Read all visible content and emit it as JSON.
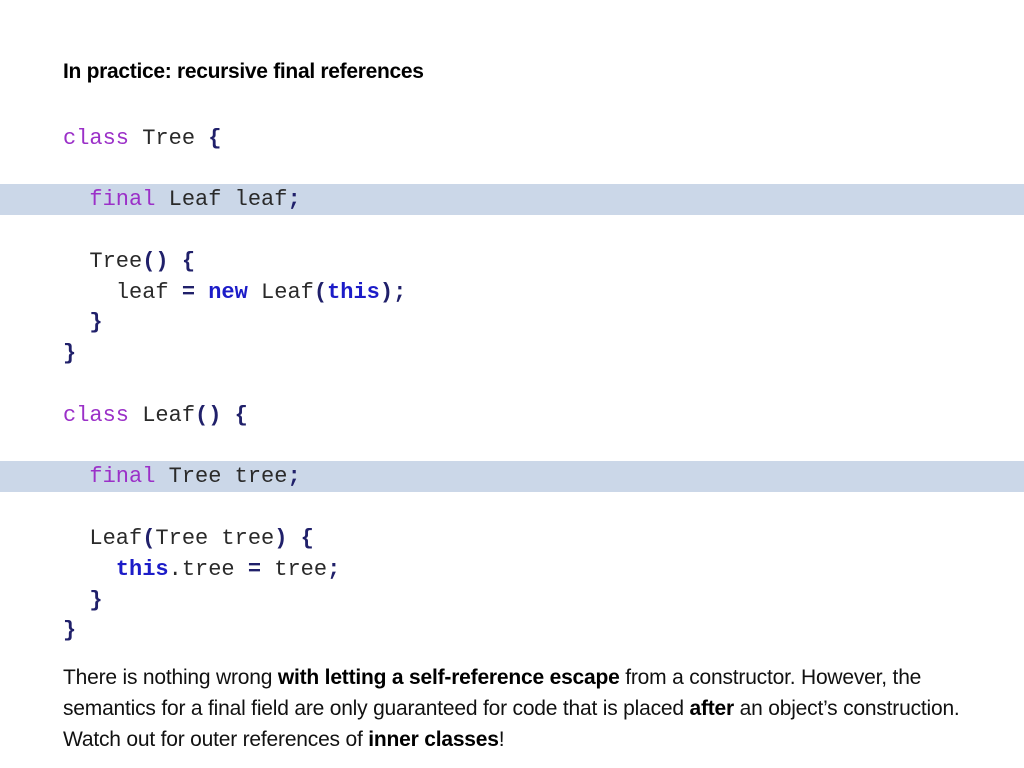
{
  "slide": {
    "title": "In practice: recursive final references"
  },
  "code": {
    "l1": {
      "kw": "class",
      "name": " Tree ",
      "brace": "{"
    },
    "l2": {
      "indent": "  ",
      "kw": "final",
      "rest": " Leaf leaf",
      "semi": ";"
    },
    "l3": {
      "indent": "  ",
      "name": "Tree",
      "parens": "()",
      "sp": " ",
      "brace": "{"
    },
    "l4": {
      "indent": "    ",
      "lhs": "leaf ",
      "eq": "=",
      "sp": " ",
      "new": "new",
      "cls": " Leaf",
      "open": "(",
      "this": "this",
      "close": ")",
      "semi": ";"
    },
    "l5": {
      "indent": "  ",
      "brace": "}"
    },
    "l6": {
      "brace": "}"
    },
    "l7": {
      "kw": "class",
      "name": " Leaf",
      "parens": "()",
      "sp": " ",
      "brace": "{"
    },
    "l8": {
      "indent": "  ",
      "kw": "final",
      "rest": " Tree tree",
      "semi": ";"
    },
    "l9": {
      "indent": "  ",
      "name": "Leaf",
      "open": "(",
      "param": "Tree tree",
      "close": ")",
      "sp": " ",
      "brace": "{"
    },
    "l10": {
      "indent": "    ",
      "this": "this",
      "rest": ".tree ",
      "eq": "=",
      "rhs": " tree",
      "semi": ";"
    },
    "l11": {
      "indent": "  ",
      "brace": "}"
    },
    "l12": {
      "brace": "}"
    }
  },
  "note": {
    "p1": "There is nothing wrong ",
    "b1": "with letting a self-reference escape",
    "p2": " from a constructor. However, the semantics for a final field are only guaranteed for code that is placed ",
    "b2": "after",
    "p3": " an object’s construction. Watch out for outer references of ",
    "b3": "inner classes",
    "p4": "!"
  },
  "colors": {
    "highlight": "#cbd7e8",
    "keyword": "#9b30c8",
    "keyword_bold": "#1c1cc8",
    "punctuation": "#20206a"
  }
}
